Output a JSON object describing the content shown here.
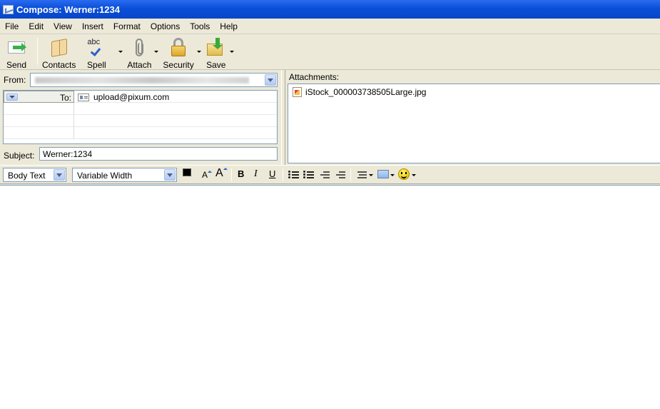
{
  "window": {
    "title": "Compose: Werner:1234"
  },
  "menu": [
    "File",
    "Edit",
    "View",
    "Insert",
    "Format",
    "Options",
    "Tools",
    "Help"
  ],
  "toolbar": {
    "send": "Send",
    "contacts": "Contacts",
    "spell": "Spell",
    "spell_glyph": "abc",
    "attach": "Attach",
    "security": "Security",
    "save": "Save"
  },
  "header": {
    "from_label": "From:",
    "to_label": "To:",
    "to_value": "upload@pixum.com",
    "subject_label": "Subject:",
    "subject_value": "Werner:1234",
    "attachments_label": "Attachments:",
    "attachment": "iStock_000003738505Large.jpg"
  },
  "format": {
    "paragraph_style": "Body Text",
    "font": "Variable Width",
    "bold": "B",
    "italic": "I",
    "underline": "U",
    "smaller": "A",
    "larger": "A"
  }
}
